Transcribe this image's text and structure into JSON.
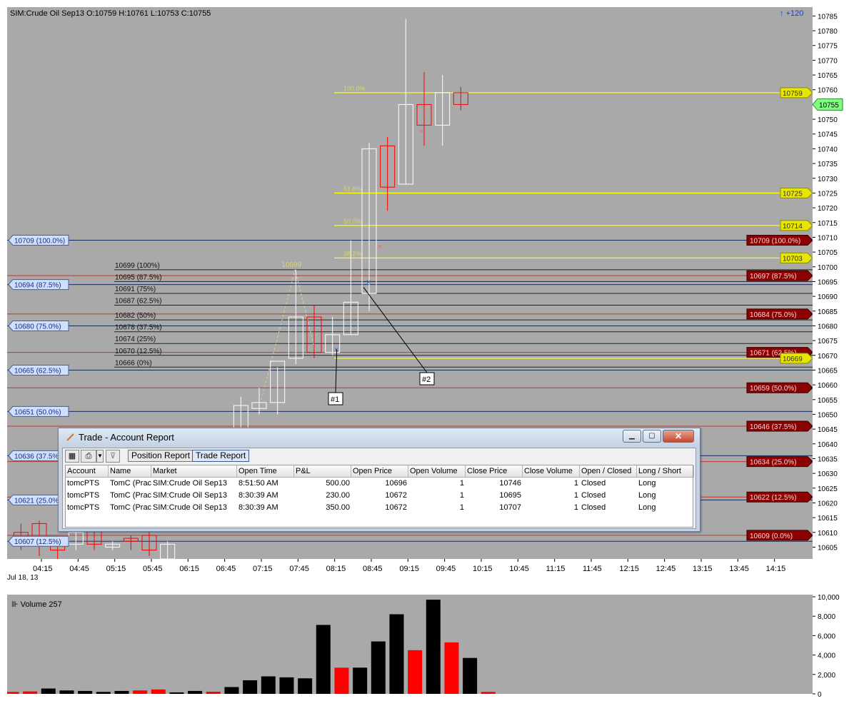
{
  "chart_header": {
    "title": "SIM:Crude Oil Sep13 O:10759 H:10761 L:10753 C:10755",
    "scroll_indicator": "+120",
    "date_label": "Jul 18, 13",
    "volume_label": "Volume 257"
  },
  "colors": {
    "background": "#a9a9a9",
    "up_candle": "#ffffff",
    "down_candle": "#ff0000",
    "fib_retrace": "#ffff00",
    "fib_blue_label": "#cfe0ff",
    "fib_red_label": "#8b0000",
    "last_price_label": "#7fff7f",
    "volume_up": "#000000",
    "volume_down": "#ff0000"
  },
  "chart_data": [
    {
      "type": "candlestick",
      "title": "SIM:Crude Oil Sep13",
      "x_ticks": [
        "04:15",
        "04:45",
        "05:15",
        "05:45",
        "06:15",
        "06:45",
        "07:15",
        "07:45",
        "08:15",
        "08:45",
        "09:15",
        "09:45",
        "10:15",
        "10:45",
        "11:15",
        "11:45",
        "12:15",
        "12:45",
        "13:15",
        "13:45",
        "14:15"
      ],
      "y_ticks": [
        10605,
        10610,
        10615,
        10620,
        10625,
        10630,
        10635,
        10640,
        10645,
        10650,
        10655,
        10660,
        10665,
        10670,
        10675,
        10680,
        10685,
        10690,
        10695,
        10700,
        10705,
        10710,
        10715,
        10720,
        10725,
        10730,
        10735,
        10740,
        10745,
        10750,
        10755,
        10760,
        10765,
        10770,
        10775,
        10780,
        10785
      ],
      "ylim": [
        10601,
        10788
      ],
      "x_minutes_range": [
        "04:00",
        "14:30"
      ],
      "candles": [
        {
          "t": "04:00",
          "o": 10610,
          "h": 10613,
          "l": 10604,
          "c": 10608
        },
        {
          "t": "04:15",
          "o": 10613,
          "h": 10614,
          "l": 10602,
          "c": 10607
        },
        {
          "t": "04:30",
          "o": 10606,
          "h": 10608,
          "l": 10600,
          "c": 10604
        },
        {
          "t": "04:45",
          "o": 10606,
          "h": 10611,
          "l": 10604,
          "c": 10610
        },
        {
          "t": "05:00",
          "o": 10611,
          "h": 10612,
          "l": 10604,
          "c": 10606
        },
        {
          "t": "05:15",
          "o": 10605,
          "h": 10607,
          "l": 10604,
          "c": 10606
        },
        {
          "t": "05:30",
          "o": 10608,
          "h": 10609,
          "l": 10604,
          "c": 10607
        },
        {
          "t": "05:45",
          "o": 10609,
          "h": 10611,
          "l": 10602,
          "c": 10604
        },
        {
          "t": "06:00",
          "o": 10601,
          "h": 10607,
          "l": 10600,
          "c": 10606
        },
        {
          "t": "07:00",
          "o": 10645,
          "h": 10656,
          "l": 10643,
          "c": 10653
        },
        {
          "t": "07:15",
          "o": 10652,
          "h": 10659,
          "l": 10650,
          "c": 10654
        },
        {
          "t": "07:30",
          "o": 10654,
          "h": 10666,
          "l": 10650,
          "c": 10668
        },
        {
          "t": "07:45",
          "o": 10669,
          "h": 10699,
          "l": 10667,
          "c": 10683
        },
        {
          "t": "08:00",
          "o": 10683,
          "h": 10687,
          "l": 10669,
          "c": 10671
        },
        {
          "t": "08:15",
          "o": 10671,
          "h": 10683,
          "l": 10670,
          "c": 10677
        },
        {
          "t": "08:30",
          "o": 10677,
          "h": 10709,
          "l": 10677,
          "c": 10688
        },
        {
          "t": "08:45",
          "o": 10691,
          "h": 10742,
          "l": 10685,
          "c": 10740
        },
        {
          "t": "09:00",
          "o": 10741,
          "h": 10744,
          "l": 10719,
          "c": 10727
        },
        {
          "t": "09:15",
          "o": 10728,
          "h": 10784,
          "l": 10728,
          "c": 10755
        },
        {
          "t": "09:30",
          "o": 10755,
          "h": 10766,
          "l": 10741,
          "c": 10748
        },
        {
          "t": "09:45",
          "o": 10748,
          "h": 10765,
          "l": 10741,
          "c": 10759
        },
        {
          "t": "10:00",
          "o": 10759,
          "h": 10761,
          "l": 10753,
          "c": 10755
        }
      ],
      "fib_retracement_levels": [
        {
          "label": "100.0%",
          "price": 10759
        },
        {
          "label": "61.8%",
          "price": 10725
        },
        {
          "label": "50.0%",
          "price": 10714
        },
        {
          "label": "38.2%",
          "price": 10703
        },
        {
          "label": "",
          "price": 10669
        }
      ],
      "fib_right_labels": [
        {
          "text": "10709 (100.0%)",
          "price": 10709
        },
        {
          "text": "10697 (87.5%)",
          "price": 10697
        },
        {
          "text": "10684 (75.0%)",
          "price": 10684
        },
        {
          "text": "10671 (62.5%)",
          "price": 10671
        },
        {
          "text": "10659 (50.0%)",
          "price": 10659
        },
        {
          "text": "10646 (37.5%)",
          "price": 10646
        },
        {
          "text": "10634 (25.0%)",
          "price": 10634
        },
        {
          "text": "10622 (12.5%)",
          "price": 10622
        },
        {
          "text": "10609 (0.0%)",
          "price": 10609
        }
      ],
      "fib_left_labels": [
        {
          "text": "10709 (100.0%)",
          "price": 10709
        },
        {
          "text": "10694 (87.5%)",
          "price": 10694
        },
        {
          "text": "10680 (75.0%)",
          "price": 10680
        },
        {
          "text": "10665 (62.5%)",
          "price": 10665
        },
        {
          "text": "10651 (50.0%)",
          "price": 10651
        },
        {
          "text": "10636 (37.5%)",
          "price": 10636
        },
        {
          "text": "10621 (25.0%)",
          "price": 10621
        },
        {
          "text": "10607 (12.5%)",
          "price": 10607
        }
      ],
      "fib_mid_labels": [
        {
          "text": "10699 (100%)",
          "price": 10699
        },
        {
          "text": "10695 (87.5%)",
          "price": 10695
        },
        {
          "text": "10691 (75%)",
          "price": 10691
        },
        {
          "text": "10687 (62.5%)",
          "price": 10687
        },
        {
          "text": "10682 (50%)",
          "price": 10682
        },
        {
          "text": "10678 (37.5%)",
          "price": 10678
        },
        {
          "text": "10674 (25%)",
          "price": 10674
        },
        {
          "text": "10670 (12.5%)",
          "price": 10670
        },
        {
          "text": "10666 (0%)",
          "price": 10666
        }
      ],
      "price_labels_right": [
        {
          "text": "10759",
          "price": 10759
        },
        {
          "text": "10725",
          "price": 10725
        },
        {
          "text": "10714",
          "price": 10714
        },
        {
          "text": "10703",
          "price": 10703
        },
        {
          "text": "10669",
          "price": 10669
        }
      ],
      "last_price": {
        "text": "10755",
        "price": 10755
      },
      "swing_high_label": {
        "text": "10699",
        "price": 10699
      },
      "trade_markers": [
        {
          "label": "#1",
          "entry_price": 10672
        },
        {
          "label": "#2",
          "entry_price": 10695
        }
      ]
    },
    {
      "type": "bar",
      "title": "Volume",
      "y_ticks": [
        "0",
        "2,000",
        "4,000",
        "6,000",
        "8,000",
        "10,000"
      ],
      "ylim": [
        0,
        10000
      ],
      "values": [
        200,
        250,
        550,
        350,
        300,
        200,
        300,
        350,
        450,
        150,
        300,
        220,
        700,
        1400,
        1800,
        1700,
        1600,
        7100,
        2700,
        2700,
        5400,
        8200,
        4500,
        9700,
        5300,
        3700,
        200
      ],
      "directions": [
        "d",
        "d",
        "u",
        "u",
        "u",
        "u",
        "u",
        "d",
        "d",
        "u",
        "u",
        "d",
        "u",
        "u",
        "u",
        "u",
        "u",
        "u",
        "d",
        "u",
        "u",
        "u",
        "d",
        "u",
        "d",
        "u",
        "d"
      ]
    }
  ],
  "trade_window": {
    "title": "Trade - Account Report",
    "tabs": [
      "Position Report",
      "Trade Report"
    ],
    "active_tab": "Trade Report",
    "columns": [
      "Account",
      "Name",
      "Market",
      "Open Time",
      "P&L",
      "Open Price",
      "Open Volume",
      "Close Price",
      "Close Volume",
      "Open / Closed",
      "Long / Short"
    ],
    "rows": [
      [
        "tomcPTS",
        "TomC (Prac",
        "SIM:Crude Oil Sep13",
        "8:51:50 AM",
        "500.00",
        "10696",
        "1",
        "10746",
        "1",
        "Closed",
        "Long"
      ],
      [
        "tomcPTS",
        "TomC (Prac",
        "SIM:Crude Oil Sep13",
        "8:30:39 AM",
        "230.00",
        "10672",
        "1",
        "10695",
        "1",
        "Closed",
        "Long"
      ],
      [
        "tomcPTS",
        "TomC (Prac",
        "SIM:Crude Oil Sep13",
        "8:30:39 AM",
        "350.00",
        "10672",
        "1",
        "10707",
        "1",
        "Closed",
        "Long"
      ]
    ]
  }
}
